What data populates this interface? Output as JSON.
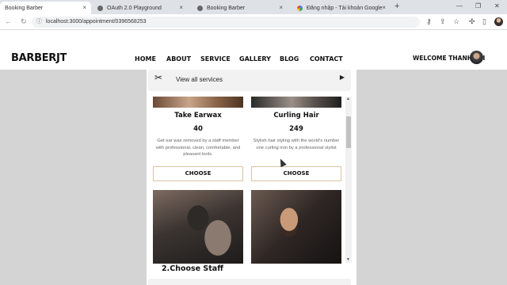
{
  "browser": {
    "tabs": [
      {
        "title": "Booking Barber",
        "icon": "site-icon",
        "active": true
      },
      {
        "title": "OAuth 2.0 Playground",
        "icon": "globe-icon",
        "active": false
      },
      {
        "title": "Booking Barber",
        "icon": "globe-icon",
        "active": false
      },
      {
        "title": "Đăng nhập - Tài khoản Google",
        "icon": "google-icon",
        "active": false
      }
    ],
    "url": "localhost:3000/appointment/0396568253",
    "new_tab": "+",
    "close_glyph": "×"
  },
  "site": {
    "logo": "BARBERJT",
    "menu": [
      "HOME",
      "ABOUT",
      "SERVICE",
      "GALLERY",
      "BLOG",
      "CONTACT"
    ],
    "welcome": "WELCOME THANH TRI"
  },
  "appointment": {
    "services_label": "View all services",
    "services": [
      {
        "name": "Take Earwax",
        "price": "40",
        "description": "Get ear wax removed by a staff member with professional, clean, comfortable, and pleasant tools.",
        "button": "CHOOSE"
      },
      {
        "name": "Curling Hair",
        "price": "249",
        "description": "Stylish hair styling with the world's number one curling iron by a professional stylist",
        "button": "CHOOSE"
      }
    ],
    "staff_heading": "2.Choose Staff"
  },
  "colors": {
    "page_bg": "#d4d4d4",
    "button_border": "#d9c4a3"
  }
}
